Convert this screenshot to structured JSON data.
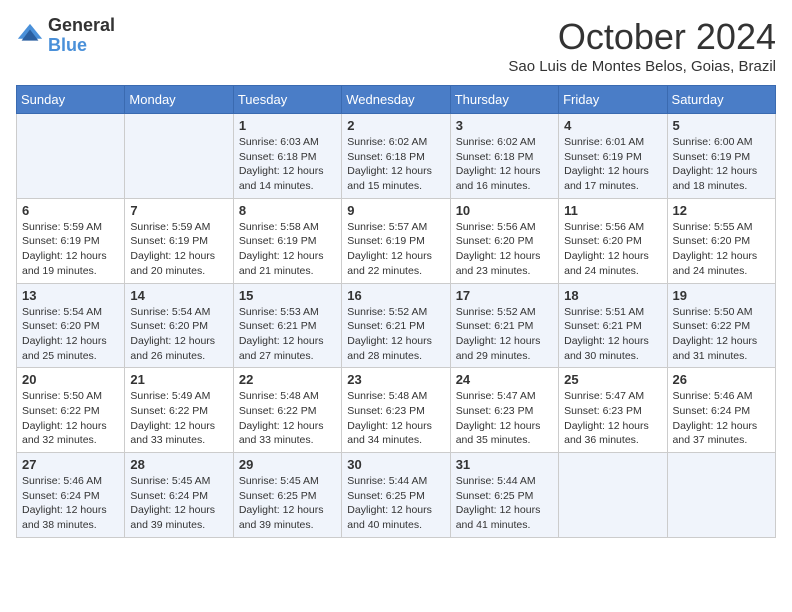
{
  "logo": {
    "general": "General",
    "blue": "Blue"
  },
  "header": {
    "month": "October 2024",
    "location": "Sao Luis de Montes Belos, Goias, Brazil"
  },
  "weekdays": [
    "Sunday",
    "Monday",
    "Tuesday",
    "Wednesday",
    "Thursday",
    "Friday",
    "Saturday"
  ],
  "weeks": [
    [
      {
        "day": "",
        "info": ""
      },
      {
        "day": "",
        "info": ""
      },
      {
        "day": "1",
        "info": "Sunrise: 6:03 AM\nSunset: 6:18 PM\nDaylight: 12 hours and 14 minutes."
      },
      {
        "day": "2",
        "info": "Sunrise: 6:02 AM\nSunset: 6:18 PM\nDaylight: 12 hours and 15 minutes."
      },
      {
        "day": "3",
        "info": "Sunrise: 6:02 AM\nSunset: 6:18 PM\nDaylight: 12 hours and 16 minutes."
      },
      {
        "day": "4",
        "info": "Sunrise: 6:01 AM\nSunset: 6:19 PM\nDaylight: 12 hours and 17 minutes."
      },
      {
        "day": "5",
        "info": "Sunrise: 6:00 AM\nSunset: 6:19 PM\nDaylight: 12 hours and 18 minutes."
      }
    ],
    [
      {
        "day": "6",
        "info": "Sunrise: 5:59 AM\nSunset: 6:19 PM\nDaylight: 12 hours and 19 minutes."
      },
      {
        "day": "7",
        "info": "Sunrise: 5:59 AM\nSunset: 6:19 PM\nDaylight: 12 hours and 20 minutes."
      },
      {
        "day": "8",
        "info": "Sunrise: 5:58 AM\nSunset: 6:19 PM\nDaylight: 12 hours and 21 minutes."
      },
      {
        "day": "9",
        "info": "Sunrise: 5:57 AM\nSunset: 6:19 PM\nDaylight: 12 hours and 22 minutes."
      },
      {
        "day": "10",
        "info": "Sunrise: 5:56 AM\nSunset: 6:20 PM\nDaylight: 12 hours and 23 minutes."
      },
      {
        "day": "11",
        "info": "Sunrise: 5:56 AM\nSunset: 6:20 PM\nDaylight: 12 hours and 24 minutes."
      },
      {
        "day": "12",
        "info": "Sunrise: 5:55 AM\nSunset: 6:20 PM\nDaylight: 12 hours and 24 minutes."
      }
    ],
    [
      {
        "day": "13",
        "info": "Sunrise: 5:54 AM\nSunset: 6:20 PM\nDaylight: 12 hours and 25 minutes."
      },
      {
        "day": "14",
        "info": "Sunrise: 5:54 AM\nSunset: 6:20 PM\nDaylight: 12 hours and 26 minutes."
      },
      {
        "day": "15",
        "info": "Sunrise: 5:53 AM\nSunset: 6:21 PM\nDaylight: 12 hours and 27 minutes."
      },
      {
        "day": "16",
        "info": "Sunrise: 5:52 AM\nSunset: 6:21 PM\nDaylight: 12 hours and 28 minutes."
      },
      {
        "day": "17",
        "info": "Sunrise: 5:52 AM\nSunset: 6:21 PM\nDaylight: 12 hours and 29 minutes."
      },
      {
        "day": "18",
        "info": "Sunrise: 5:51 AM\nSunset: 6:21 PM\nDaylight: 12 hours and 30 minutes."
      },
      {
        "day": "19",
        "info": "Sunrise: 5:50 AM\nSunset: 6:22 PM\nDaylight: 12 hours and 31 minutes."
      }
    ],
    [
      {
        "day": "20",
        "info": "Sunrise: 5:50 AM\nSunset: 6:22 PM\nDaylight: 12 hours and 32 minutes."
      },
      {
        "day": "21",
        "info": "Sunrise: 5:49 AM\nSunset: 6:22 PM\nDaylight: 12 hours and 33 minutes."
      },
      {
        "day": "22",
        "info": "Sunrise: 5:48 AM\nSunset: 6:22 PM\nDaylight: 12 hours and 33 minutes."
      },
      {
        "day": "23",
        "info": "Sunrise: 5:48 AM\nSunset: 6:23 PM\nDaylight: 12 hours and 34 minutes."
      },
      {
        "day": "24",
        "info": "Sunrise: 5:47 AM\nSunset: 6:23 PM\nDaylight: 12 hours and 35 minutes."
      },
      {
        "day": "25",
        "info": "Sunrise: 5:47 AM\nSunset: 6:23 PM\nDaylight: 12 hours and 36 minutes."
      },
      {
        "day": "26",
        "info": "Sunrise: 5:46 AM\nSunset: 6:24 PM\nDaylight: 12 hours and 37 minutes."
      }
    ],
    [
      {
        "day": "27",
        "info": "Sunrise: 5:46 AM\nSunset: 6:24 PM\nDaylight: 12 hours and 38 minutes."
      },
      {
        "day": "28",
        "info": "Sunrise: 5:45 AM\nSunset: 6:24 PM\nDaylight: 12 hours and 39 minutes."
      },
      {
        "day": "29",
        "info": "Sunrise: 5:45 AM\nSunset: 6:25 PM\nDaylight: 12 hours and 39 minutes."
      },
      {
        "day": "30",
        "info": "Sunrise: 5:44 AM\nSunset: 6:25 PM\nDaylight: 12 hours and 40 minutes."
      },
      {
        "day": "31",
        "info": "Sunrise: 5:44 AM\nSunset: 6:25 PM\nDaylight: 12 hours and 41 minutes."
      },
      {
        "day": "",
        "info": ""
      },
      {
        "day": "",
        "info": ""
      }
    ]
  ]
}
